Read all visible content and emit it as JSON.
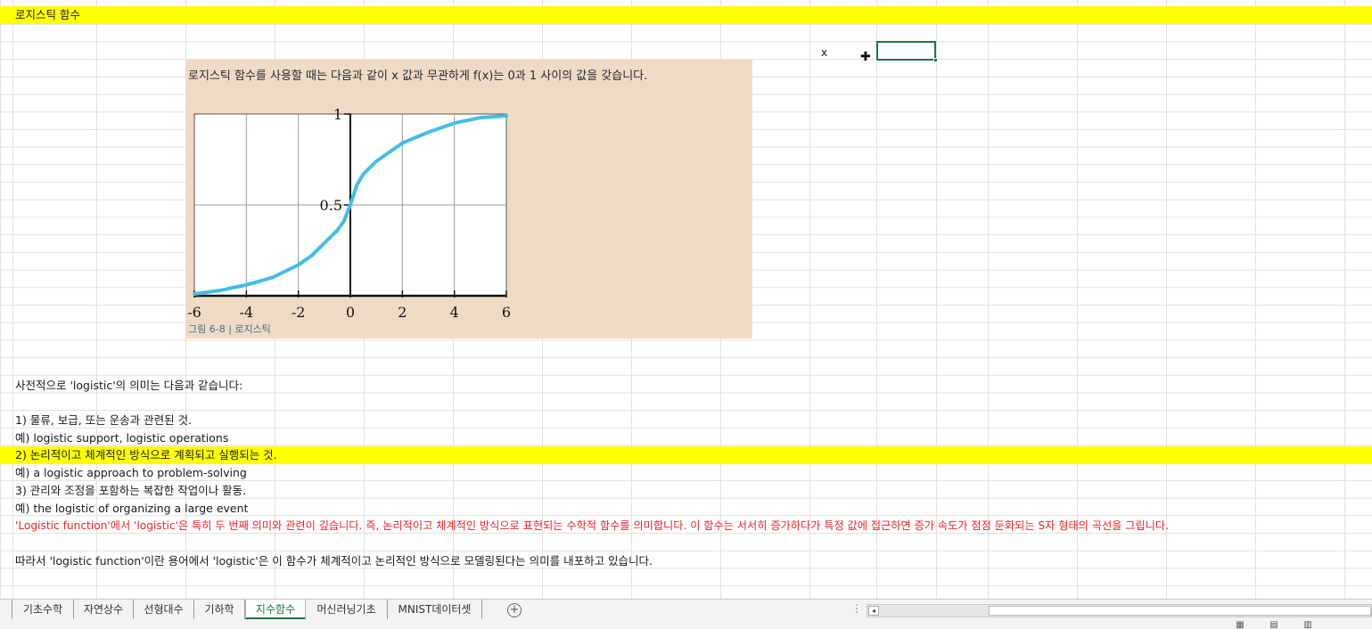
{
  "sheet": {
    "title": "로지스틱 함수",
    "x_label": "x",
    "image": {
      "caption": "로지스틱 함수를 사용할 때는 다음과 같이 x 값과 무관하게 f(x)는 0과 1 사이의 값을 갖습니다.",
      "figure_label": "그림 6-8 | 로지스틱"
    },
    "lines": [
      {
        "text": "사전적으로 'logistic'의 의미는 다음과 같습니다:"
      },
      {
        "text": "1) 물류, 보급, 또는 운송과 관련된 것."
      },
      {
        "text": "예) logistic support, logistic operations"
      },
      {
        "text": "2) 논리적이고 체계적인 방식으로 계획되고 실행되는 것."
      },
      {
        "text": "예) a logistic approach to problem-solving"
      },
      {
        "text": "3) 관리와 조정을 포함하는 복잡한 작업이나 활동."
      },
      {
        "text": "예) the logistic of organizing a large event"
      },
      {
        "text": "'Logistic function'에서 'logistic'은 특히 두 번째 의미와 관련이 깊습니다. 즉, 논리적이고 체계적인 방식으로 표현되는 수학적 함수를 의미합니다. 이 함수는 서서히 증가하다가 특정 값에 접근하면 증가 속도가 점점 둔화되는 S자 형태의 곡선을 그립니다."
      },
      {
        "text": "따라서 'logistic function'이란 용어에서 'logistic'은 이 함수가 체계적이고 논리적인 방식으로 모델링된다는 의미를 내포하고 있습니다."
      }
    ]
  },
  "chart_data": {
    "type": "line",
    "title": "",
    "xlabel": "",
    "ylabel": "",
    "xlim": [
      -6,
      6
    ],
    "ylim": [
      0,
      1
    ],
    "x_ticks": [
      "-6",
      "-4",
      "-2",
      "0",
      "2",
      "4",
      "6"
    ],
    "y_ticks": [
      "0.5",
      "1"
    ],
    "grid": true,
    "color": "#45bde6",
    "series": [
      {
        "x": [
          -6,
          -5,
          -4,
          -3,
          -2,
          -1.5,
          -1,
          -0.5,
          -0.25,
          0,
          0.25,
          0.5,
          1,
          1.5,
          2,
          3,
          4,
          5,
          6
        ],
        "y": [
          0.01,
          0.03,
          0.06,
          0.1,
          0.17,
          0.22,
          0.29,
          0.36,
          0.41,
          0.5,
          0.61,
          0.67,
          0.74,
          0.79,
          0.84,
          0.9,
          0.95,
          0.98,
          0.99
        ]
      }
    ]
  },
  "tabs": [
    {
      "label": "기초수학",
      "active": false
    },
    {
      "label": "자연상수",
      "active": false
    },
    {
      "label": "선형대수",
      "active": false
    },
    {
      "label": "기하학",
      "active": false
    },
    {
      "label": "지수함수",
      "active": true
    },
    {
      "label": "머신러닝기초",
      "active": false
    },
    {
      "label": "MNIST데이터셋",
      "active": false
    }
  ],
  "tabbar": {
    "add_symbol": "+",
    "dots": "⋮",
    "scroll_left": "◂"
  },
  "colors": {
    "highlight": "#ffff00",
    "accent": "#217346",
    "image_bg": "#efdac6",
    "red_text": "#e8262c"
  }
}
